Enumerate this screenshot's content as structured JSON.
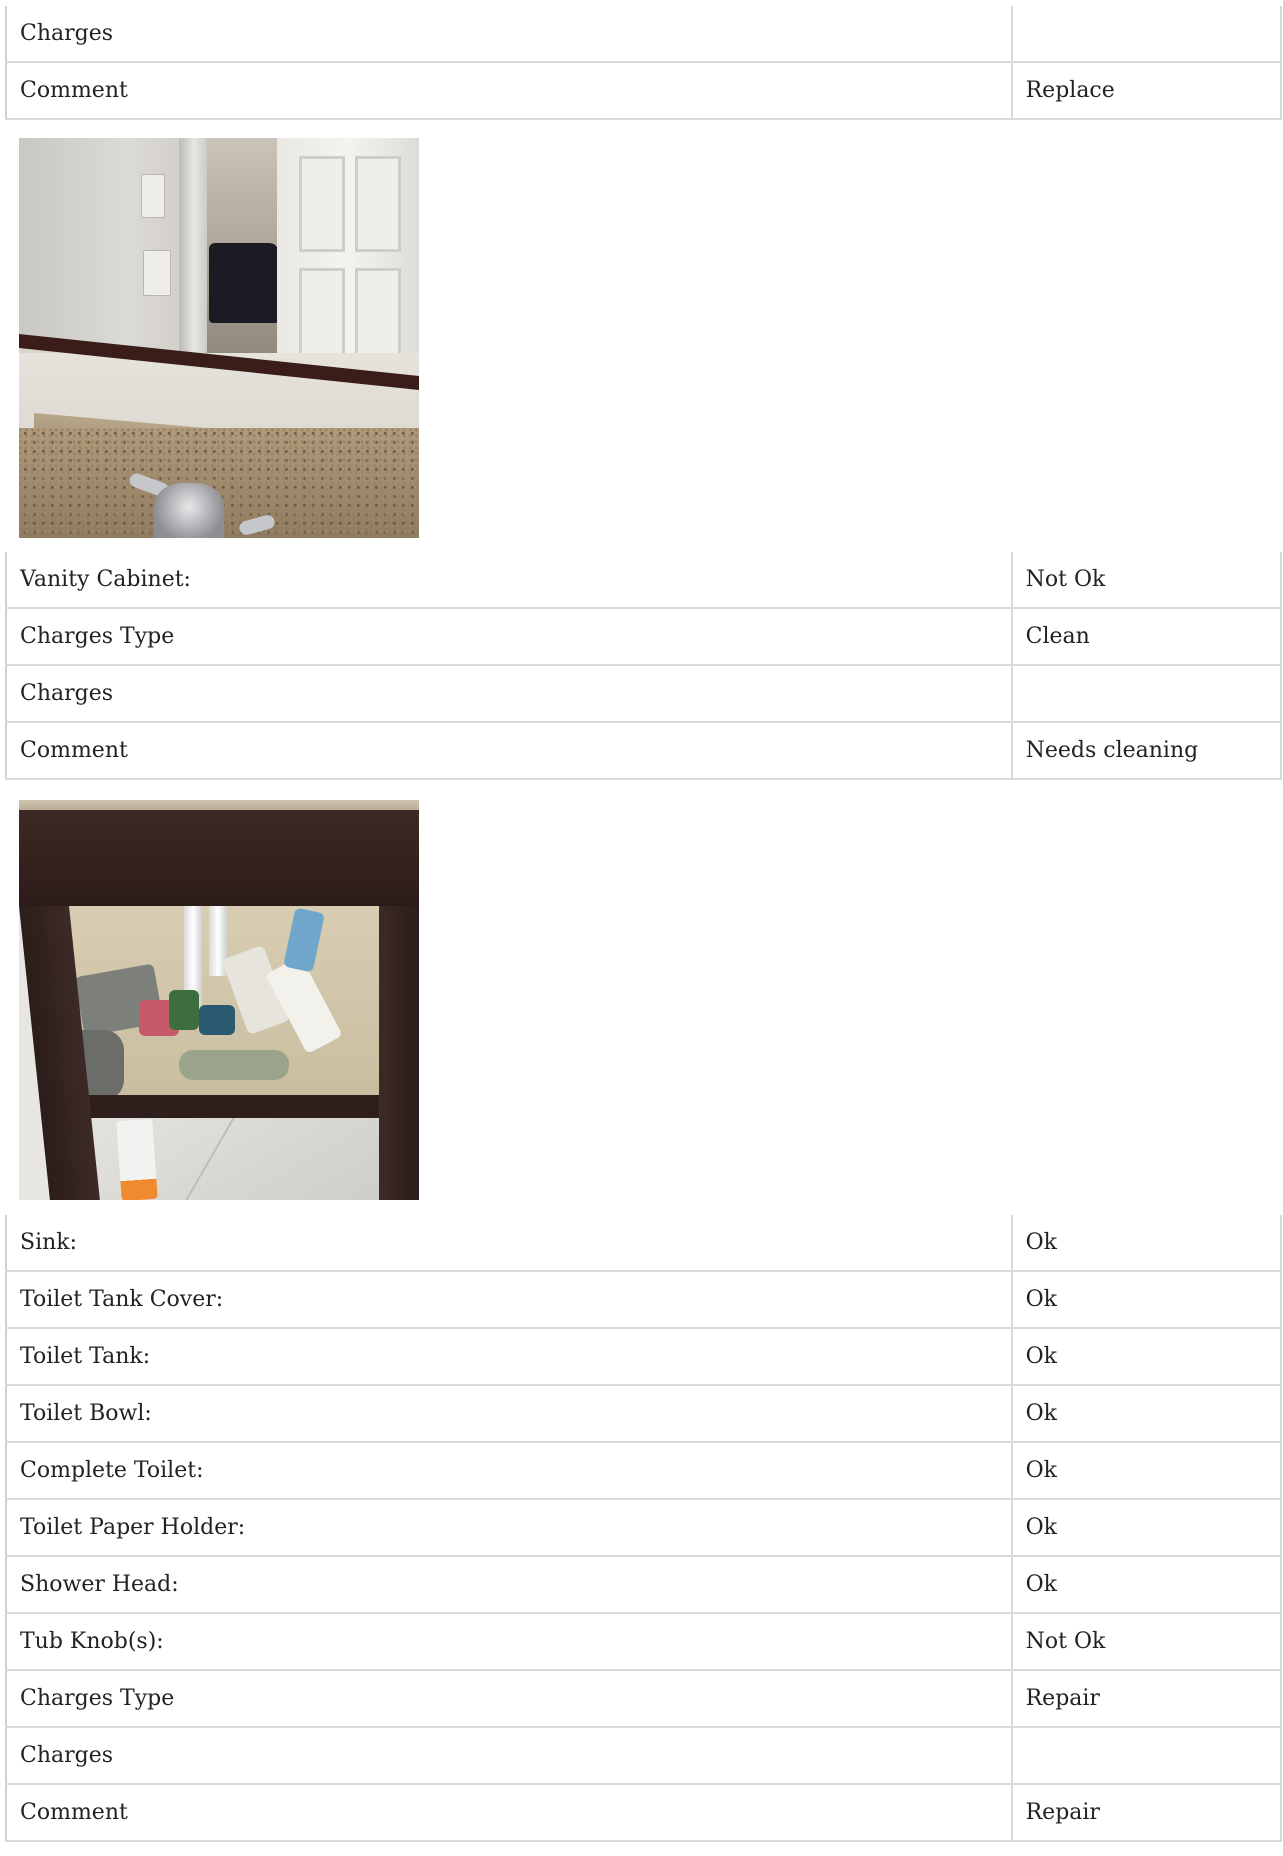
{
  "table1": {
    "rows": [
      {
        "label": "Charges",
        "value": ""
      },
      {
        "label": "Comment",
        "value": "Replace"
      }
    ]
  },
  "photo1": {
    "alt": ""
  },
  "table2": {
    "rows": [
      {
        "label": "Vanity Cabinet:",
        "value": "Not Ok"
      },
      {
        "label": "Charges Type",
        "value": "Clean"
      },
      {
        "label": "Charges",
        "value": ""
      },
      {
        "label": "Comment",
        "value": "Needs cleaning"
      }
    ]
  },
  "photo2": {
    "alt": ""
  },
  "table3": {
    "rows": [
      {
        "label": "Sink:",
        "value": "Ok"
      },
      {
        "label": "Toilet Tank Cover:",
        "value": "Ok"
      },
      {
        "label": "Toilet Tank:",
        "value": "Ok"
      },
      {
        "label": "Toilet Bowl:",
        "value": "Ok"
      },
      {
        "label": "Complete Toilet:",
        "value": "Ok"
      },
      {
        "label": "Toilet Paper Holder:",
        "value": "Ok"
      },
      {
        "label": "Shower Head:",
        "value": "Ok"
      },
      {
        "label": "Tub Knob(s):",
        "value": "Not Ok"
      },
      {
        "label": "Charges Type",
        "value": "Repair"
      },
      {
        "label": "Charges",
        "value": ""
      },
      {
        "label": "Comment",
        "value": "Repair"
      }
    ]
  }
}
